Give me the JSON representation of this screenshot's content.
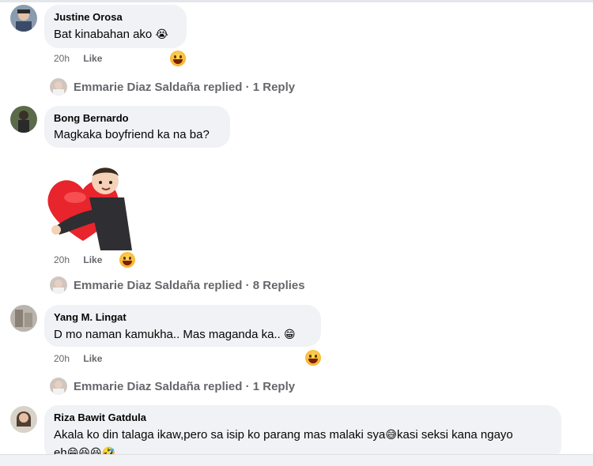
{
  "comments": [
    {
      "author": "Justine Orosa",
      "text": "Bat kinabahan ako",
      "emoji": "😭",
      "time": "20h",
      "like": "Like"
    },
    {
      "author": "Bong Bernardo",
      "text": "Magkaka boyfriend ka na ba?",
      "time": "20h",
      "like": "Like"
    },
    {
      "author": "Yang M. Lingat",
      "text": "D mo naman kamukha.. Mas maganda ka..",
      "emoji": "😁",
      "time": "20h",
      "like": "Like"
    },
    {
      "author": "Riza Bawit Gatdula",
      "text_line1": "Akala ko din talaga ikaw,pero sa isip ko parang mas malaki sya",
      "emoji_mid": "😅",
      "text_line1b": "kasi seksi kana ngayo",
      "text_line2": "eh",
      "emoji_end": "😁😆😆🤣"
    }
  ],
  "replies": [
    {
      "label": "Emmarie Diaz Saldaña replied · 1 Reply"
    },
    {
      "label": "Emmarie Diaz Saldaña replied · 8 Replies"
    },
    {
      "label": "Emmarie Diaz Saldaña replied · 1 Reply"
    }
  ],
  "colors": {
    "bubble": "#f0f2f5",
    "meta": "#65676b",
    "heart": "#e8242c",
    "reaction": "#f7b125"
  }
}
